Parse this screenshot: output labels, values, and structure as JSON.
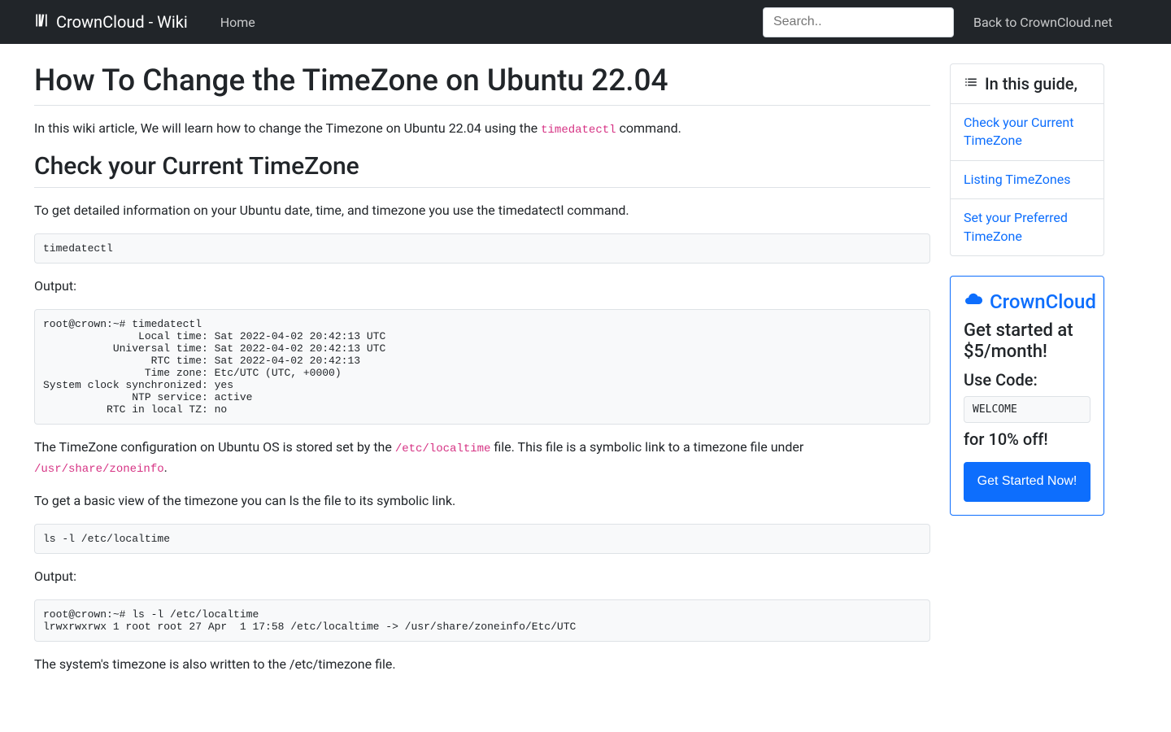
{
  "nav": {
    "brand": "CrownCloud - Wiki",
    "home": "Home",
    "search_placeholder": "Search..",
    "back_link": "Back to CrownCloud.net"
  },
  "article": {
    "title": "How To Change the TimeZone on Ubuntu 22.04",
    "intro_pre": "In this wiki article, We will learn how to change the Timezone on Ubuntu 22.04 using the ",
    "intro_code": "timedatectl",
    "intro_post": " command.",
    "sec1_heading": "Check your Current TimeZone",
    "sec1_p1": "To get detailed information on your Ubuntu date, time, and timezone you use the timedatectl command.",
    "sec1_cmd1": "timedatectl",
    "output_label": "Output:",
    "sec1_out1": "root@crown:~# timedatectl\n               Local time: Sat 2022-04-02 20:42:13 UTC\n           Universal time: Sat 2022-04-02 20:42:13 UTC\n                 RTC time: Sat 2022-04-02 20:42:13\n                Time zone: Etc/UTC (UTC, +0000)\nSystem clock synchronized: yes\n              NTP service: active\n          RTC in local TZ: no",
    "sec1_p2_a": "The TimeZone configuration on Ubuntu OS is stored set by the ",
    "sec1_p2_code1": "/etc/localtime",
    "sec1_p2_b": " file. This file is a symbolic link to a timezone file under ",
    "sec1_p2_code2": "/usr/share/zoneinfo",
    "sec1_p2_c": ".",
    "sec1_p3": "To get a basic view of the timezone you can ls the file to its symbolic link.",
    "sec1_cmd2": "ls -l /etc/localtime",
    "sec1_out2": "root@crown:~# ls -l /etc/localtime\nlrwxrwxrwx 1 root root 27 Apr  1 17:58 /etc/localtime -> /usr/share/zoneinfo/Etc/UTC",
    "sec1_p4": "The system's timezone is also written to the /etc/timezone file."
  },
  "toc": {
    "header": "In this guide,",
    "items": [
      "Check your Current TimeZone",
      "Listing TimeZones",
      "Set your Preferred TimeZone"
    ]
  },
  "promo": {
    "title": "CrownCloud",
    "subtitle": "Get started at $5/month!",
    "use_code_label": "Use Code:",
    "code": "WELCOME",
    "discount": "for 10% off!",
    "cta": "Get Started Now!"
  }
}
